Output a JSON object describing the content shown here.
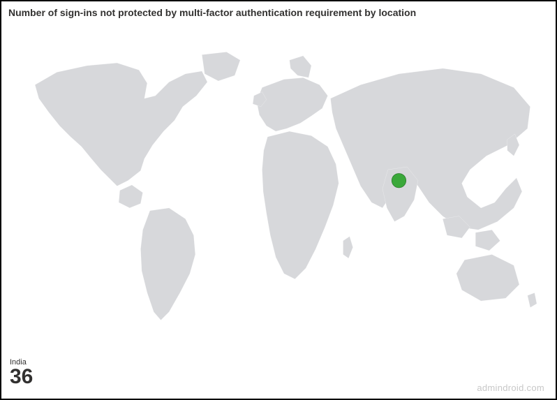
{
  "title": "Number of sign-ins not protected by multi-factor authentication requirement by location",
  "stat": {
    "label": "India",
    "value": "36"
  },
  "watermark": "admindroid.com",
  "marker": {
    "country": "India",
    "color": "#3aa83a"
  },
  "chart_data": {
    "type": "map",
    "title": "Number of sign-ins not protected by multi-factor authentication requirement by location",
    "series": [
      {
        "name": "Sign-ins",
        "points": [
          {
            "location": "India",
            "value": 36
          }
        ]
      }
    ]
  }
}
